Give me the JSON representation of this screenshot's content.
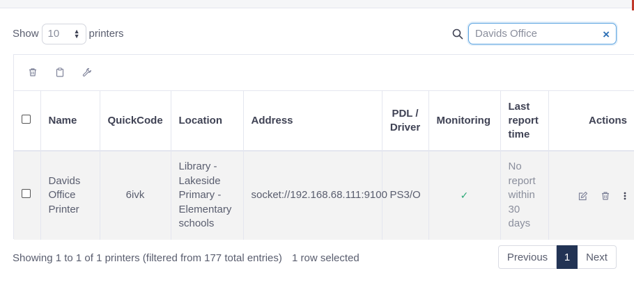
{
  "colors": {
    "accent": "#223354",
    "focus": "#5aa3e0",
    "check": "#2aa876",
    "row_bg": "#f3f3f3"
  },
  "length": {
    "prefix": "Show",
    "value": "10",
    "suffix": "printers"
  },
  "search": {
    "value": "Davids Office"
  },
  "toolbar": {
    "icons": [
      "trash-icon",
      "clipboard-icon",
      "wrench-icon"
    ]
  },
  "table": {
    "headers": {
      "name": "Name",
      "quickcode": "QuickCode",
      "location": "Location",
      "address": "Address",
      "pdl": "PDL / Driver",
      "monitoring": "Monitoring",
      "last_report": "Last report time",
      "actions": "Actions"
    },
    "rows": [
      {
        "name": "Davids Office Printer",
        "quickcode": "6ivk",
        "location": "Library - Lakeside Primary - Elementary schools",
        "address": "socket://192.168.68.111:9100",
        "pdl": "PS3/O",
        "monitoring": "✓",
        "last_report": "No report within 30 days"
      }
    ]
  },
  "footer": {
    "info": "Showing 1 to 1 of 1 printers (filtered from 177 total entries)",
    "selected": "1 row selected"
  },
  "pagination": {
    "previous": "Previous",
    "current": "1",
    "next": "Next"
  }
}
